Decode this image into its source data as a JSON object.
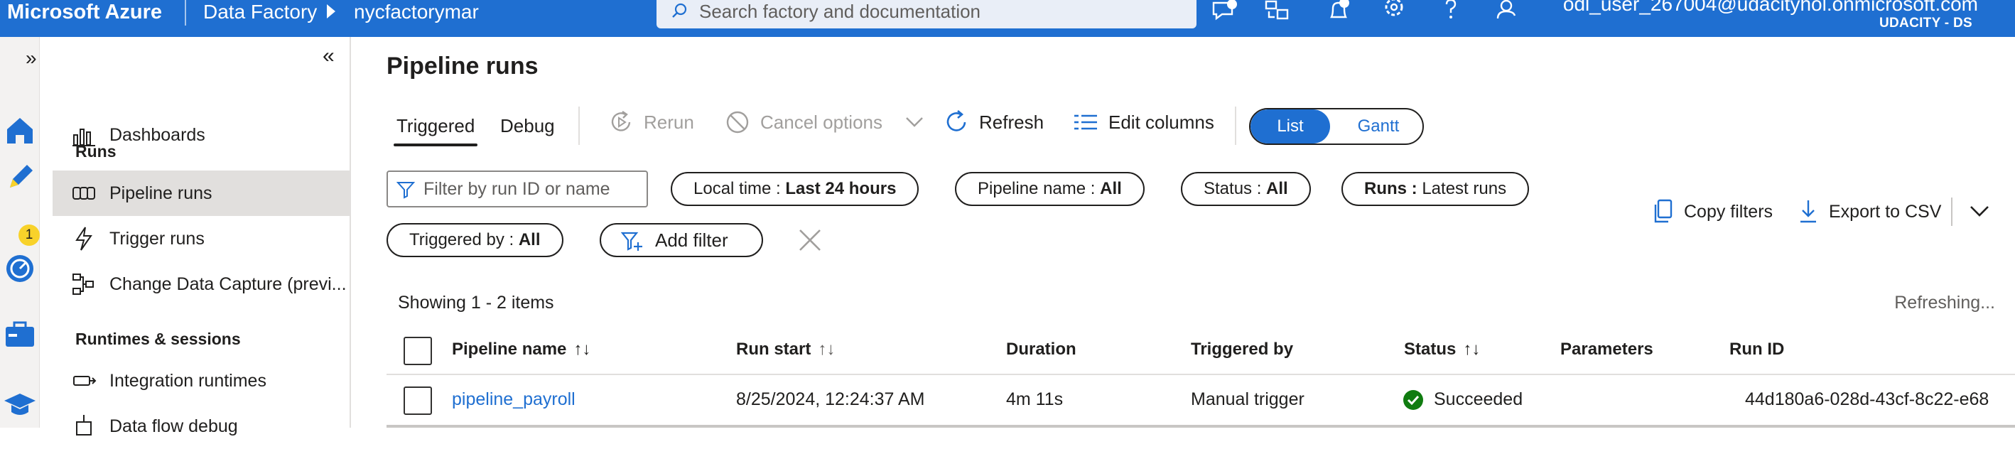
{
  "topbar": {
    "brand": "Microsoft Azure",
    "breadcrumb": [
      "Data Factory",
      "nycfactorymar"
    ],
    "search_placeholder": "Search factory and documentation",
    "icons": [
      "feedback-icon",
      "switch-directory-icon",
      "notifications-icon",
      "settings-icon",
      "help-icon",
      "account-feedback-icon"
    ],
    "user": "odl_user_267004@udacityhol.onmicrosoft.com",
    "tenant": "UDACITY - DS"
  },
  "rail": {
    "expand": "»",
    "items": [
      "home-icon",
      "author-icon",
      "monitor-icon",
      "manage-icon",
      "learning-center-icon"
    ],
    "author_badge": "1"
  },
  "nav": {
    "collapse": "«",
    "dashboards": "Dashboards",
    "runs_header": "Runs",
    "runs_items": [
      "Pipeline runs",
      "Trigger runs",
      "Change Data Capture (previ..."
    ],
    "runtimes_header": "Runtimes & sessions",
    "runtimes_items": [
      "Integration runtimes",
      "Data flow debug"
    ]
  },
  "main": {
    "title": "Pipeline runs",
    "tabs": [
      "Triggered",
      "Debug"
    ],
    "active_tab": "Triggered",
    "commands": {
      "rerun": "Rerun",
      "cancel": "Cancel options",
      "refresh": "Refresh",
      "edit_columns": "Edit columns"
    },
    "view_toggle": {
      "list": "List",
      "gantt": "Gantt",
      "selected": "List"
    },
    "filter_placeholder": "Filter by run ID or name",
    "filters": [
      {
        "label": "Local time : ",
        "value": "Last 24 hours"
      },
      {
        "label": "Pipeline name : ",
        "value": "All"
      },
      {
        "label": "Status : ",
        "value": "All"
      },
      {
        "label": "Runs : ",
        "value": "Latest runs"
      },
      {
        "label": "Triggered by : ",
        "value": "All"
      }
    ],
    "add_filter": "Add filter",
    "copy_filters": "Copy filters",
    "export_csv": "Export to CSV",
    "showing": "Showing 1 - 2 items",
    "refreshing": "Refreshing...",
    "columns": [
      "Pipeline name",
      "Run start",
      "Duration",
      "Triggered by",
      "Status",
      "Parameters",
      "Run ID"
    ],
    "sort_glyph": "↑↓",
    "rows": [
      {
        "pipeline_name": "pipeline_payroll",
        "run_start": "8/25/2024, 12:24:37 AM",
        "duration": "4m 11s",
        "triggered_by": "Manual trigger",
        "status": "Succeeded",
        "parameters": "",
        "run_id": "44d180a6-028d-43cf-8c22-e68"
      }
    ]
  },
  "colors": {
    "brand_blue": "#1f6fd1",
    "success_green": "#107c10",
    "badge_yellow": "#f8d22a"
  }
}
